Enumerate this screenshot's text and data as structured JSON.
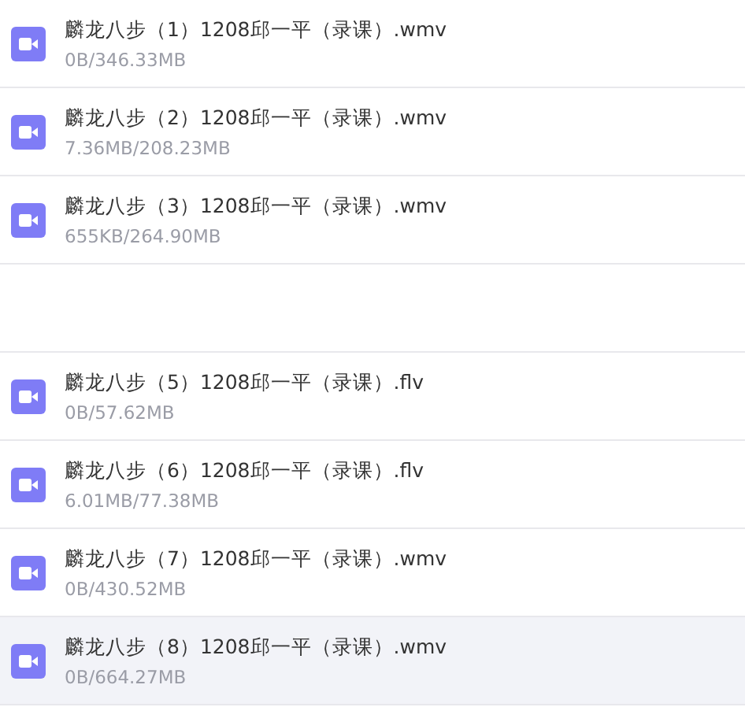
{
  "files": [
    {
      "kind": "file",
      "name": "麟龙八步（1）1208邱一平（录课）.wmv",
      "progress": "0B/346.33MB",
      "selected": false
    },
    {
      "kind": "file",
      "name": "麟龙八步（2）1208邱一平（录课）.wmv",
      "progress": "7.36MB/208.23MB",
      "selected": false
    },
    {
      "kind": "file",
      "name": "麟龙八步（3）1208邱一平（录课）.wmv",
      "progress": "655KB/264.90MB",
      "selected": false
    },
    {
      "kind": "blank"
    },
    {
      "kind": "file",
      "name": "麟龙八步（5）1208邱一平（录课）.flv",
      "progress": "0B/57.62MB",
      "selected": false
    },
    {
      "kind": "file",
      "name": "麟龙八步（6）1208邱一平（录课）.flv",
      "progress": "6.01MB/77.38MB",
      "selected": false
    },
    {
      "kind": "file",
      "name": "麟龙八步（7）1208邱一平（录课）.wmv",
      "progress": "0B/430.52MB",
      "selected": false
    },
    {
      "kind": "file",
      "name": "麟龙八步（8）1208邱一平（录课）.wmv",
      "progress": "0B/664.27MB",
      "selected": true
    }
  ]
}
